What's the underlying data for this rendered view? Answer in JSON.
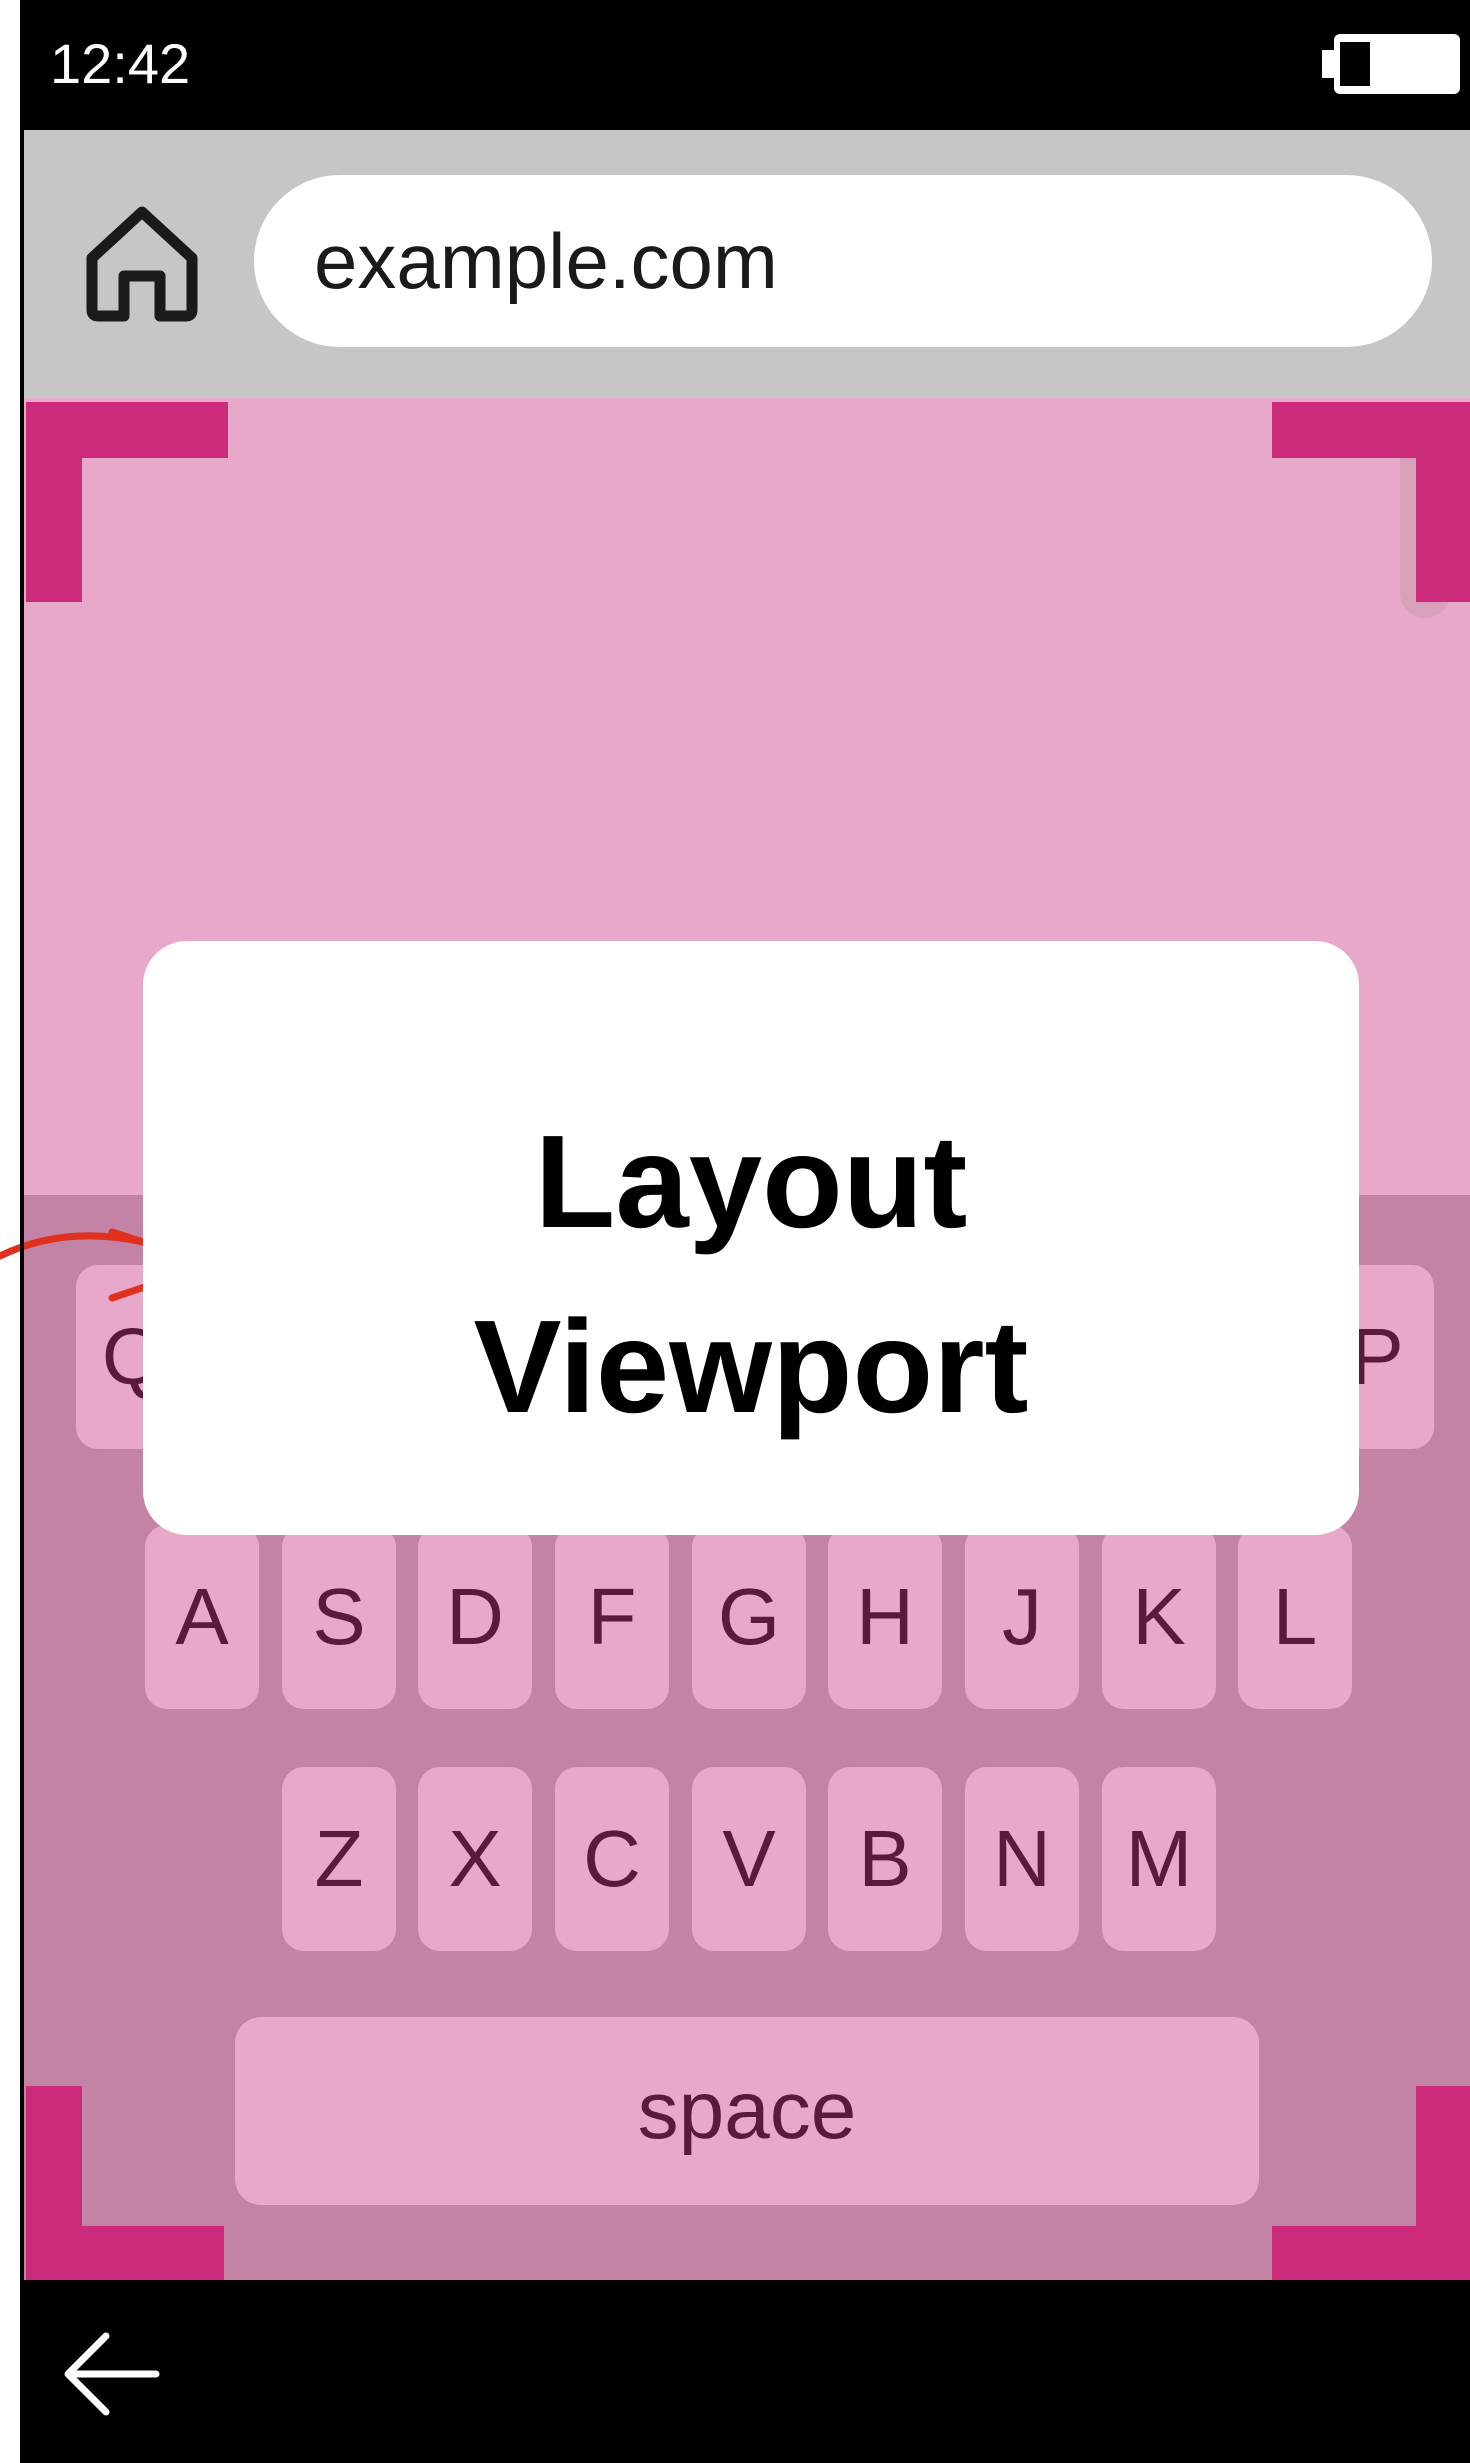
{
  "status_bar": {
    "time": "12:42",
    "battery_icon": "battery-icon"
  },
  "browser": {
    "home_icon": "home-icon",
    "url": "example.com"
  },
  "keyboard": {
    "row1": [
      "Q",
      "P"
    ],
    "row2": [
      "A",
      "S",
      "D",
      "F",
      "G",
      "H",
      "J",
      "K",
      "L"
    ],
    "row3": [
      "Z",
      "X",
      "C",
      "V",
      "B",
      "N",
      "M"
    ],
    "space_label": "space"
  },
  "overlay": {
    "line1": "Layout",
    "line2": "Viewport"
  },
  "nav": {
    "back_icon": "back-arrow-icon"
  },
  "colors": {
    "page": "#e8a8c9",
    "keyboard": "#c283a5",
    "bracket": "#cc2a7a",
    "arrow": "#e0301e"
  }
}
